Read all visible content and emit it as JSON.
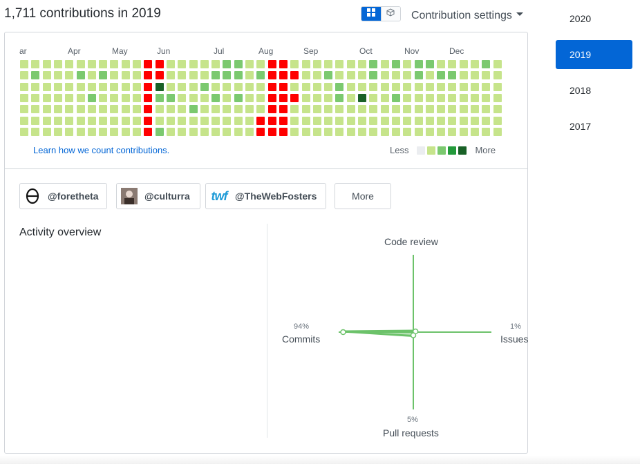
{
  "headline": "1,711 contributions in 2019",
  "view_toggle": {
    "active_icon": "grid-icon",
    "inactive_icon": "cube-icon"
  },
  "settings_label": "Contribution settings",
  "months": [
    "ar",
    "Apr",
    "May",
    "Jun",
    "Jul",
    "Aug",
    "Sep",
    "Oct",
    "Nov",
    "Dec"
  ],
  "colors": {
    "empty": "#ebedf0",
    "l1": "#c6e48b",
    "l2": "#7bc96f",
    "l3": "#239a3b",
    "l4": "#196127",
    "accent_red": "#ff0000",
    "link": "#0366d6",
    "selected_year_bg": "#0366d6",
    "radar_line": "#6cc26a"
  },
  "calendar": {
    "weeks": 43,
    "levels": [
      "1111111111112111112211111111111212122111121",
      "1211121211111111122212111112111211121221111",
      "1111111111115111211111111111211111111111111",
      "1111112111112211121211111111214112111111111",
      "1111111111111112111111111111111111111111111",
      "1111111111111111111111111111111111111111111",
      "1111111111112111111111111111111111111111111"
    ],
    "red_cells": [
      [
        11,
        0
      ],
      [
        12,
        0
      ],
      [
        22,
        0
      ],
      [
        23,
        0
      ],
      [
        11,
        1
      ],
      [
        12,
        1
      ],
      [
        22,
        1
      ],
      [
        23,
        1
      ],
      [
        24,
        1
      ],
      [
        11,
        2
      ],
      [
        22,
        2
      ],
      [
        23,
        2
      ],
      [
        11,
        3
      ],
      [
        22,
        3
      ],
      [
        23,
        3
      ],
      [
        24,
        3
      ],
      [
        11,
        4
      ],
      [
        22,
        4
      ],
      [
        23,
        4
      ],
      [
        11,
        5
      ],
      [
        21,
        5
      ],
      [
        22,
        5
      ],
      [
        23,
        5
      ],
      [
        11,
        6
      ],
      [
        21,
        6
      ],
      [
        22,
        6
      ],
      [
        23,
        6
      ]
    ]
  },
  "learn_link": "Learn how we count contributions.",
  "legend": {
    "less": "Less",
    "more": "More"
  },
  "orgs": [
    {
      "handle": "@foretheta",
      "icon": "theta-logo-icon"
    },
    {
      "handle": "@culturra",
      "icon": "person-avatar-icon"
    },
    {
      "handle": "@TheWebFosters",
      "icon": "twf-logo-icon",
      "logo_text": "twf"
    }
  ],
  "more_label": "More",
  "activity": {
    "title": "Activity overview",
    "code_review": {
      "label": "Code review"
    },
    "commits": {
      "label": "Commits",
      "pct_label": "94%",
      "value": 94
    },
    "issues": {
      "label": "Issues",
      "pct_label": "1%",
      "value": 1
    },
    "pull_requests": {
      "label": "Pull requests",
      "pct_label": "5%",
      "value": 5
    }
  },
  "years": [
    "2020",
    "2019",
    "2018",
    "2017"
  ],
  "selected_year": "2019"
}
